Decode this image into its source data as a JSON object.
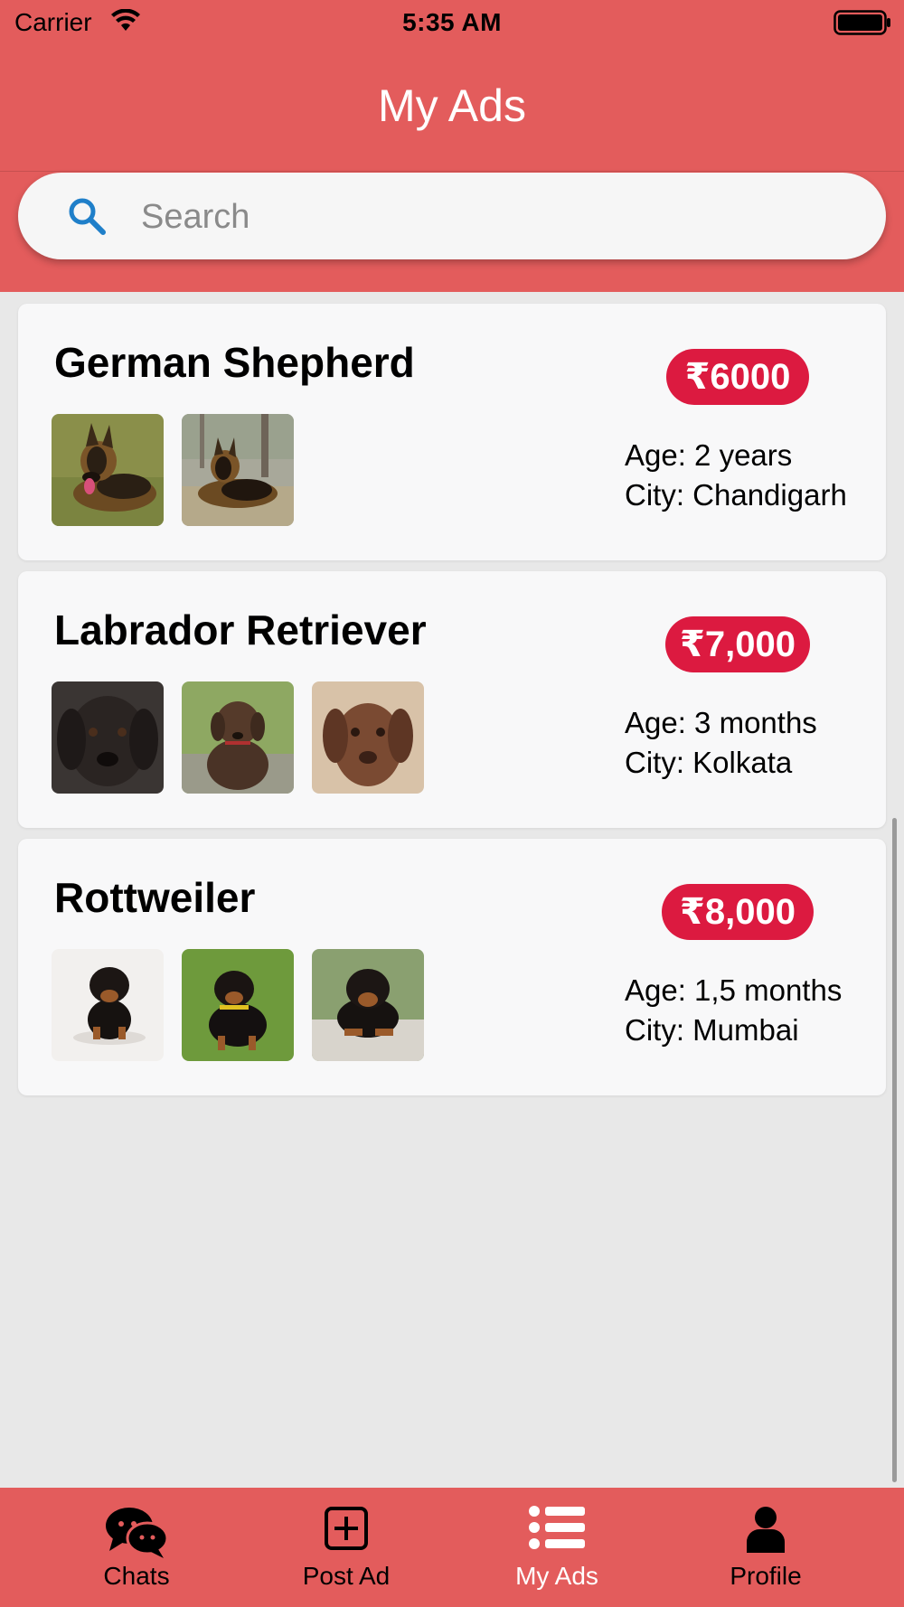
{
  "status_bar": {
    "carrier": "Carrier",
    "time": "5:35 AM"
  },
  "header": {
    "title": "My Ads"
  },
  "search": {
    "placeholder": "Search",
    "value": ""
  },
  "ads": [
    {
      "title": "German Shepherd",
      "price": "₹6000",
      "age": "Age: 2 years",
      "city": "City: Chandigarh",
      "photo_count": 2
    },
    {
      "title": "Labrador Retriever",
      "price": "₹7,000",
      "age": "Age: 3 months",
      "city": "City: Kolkata",
      "photo_count": 3
    },
    {
      "title": "Rottweiler",
      "price": "₹8,000",
      "age": "Age: 1,5 months",
      "city": "City: Mumbai",
      "photo_count": 3
    }
  ],
  "tabs": [
    {
      "label": "Chats",
      "icon": "chat-bubbles-icon",
      "active": false
    },
    {
      "label": "Post Ad",
      "icon": "plus-square-icon",
      "active": false
    },
    {
      "label": "My Ads",
      "icon": "list-icon",
      "active": true
    },
    {
      "label": "Profile",
      "icon": "user-icon",
      "active": false
    }
  ],
  "colors": {
    "header": "#e35c5c",
    "price_badge": "#dc1a40",
    "search_icon": "#1f7fc9",
    "active_tab": "#ffffff"
  }
}
